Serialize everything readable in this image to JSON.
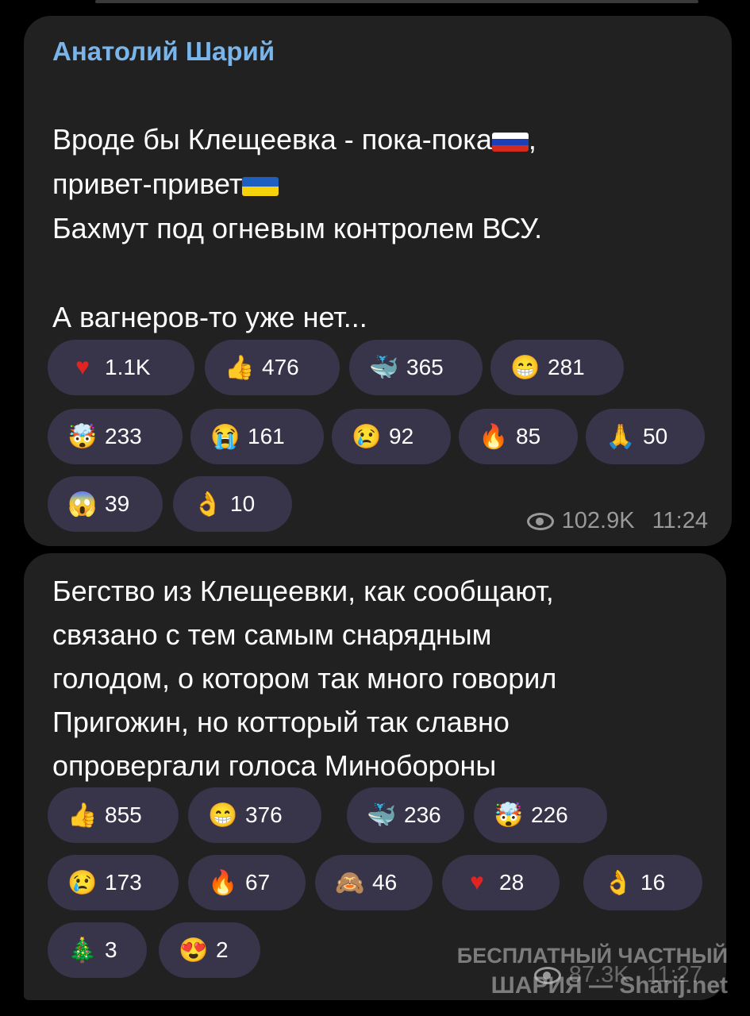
{
  "messages": [
    {
      "author": "Анатолий Шарий",
      "line1a": "Вроде бы Клещеевка - пока-пока",
      "line1b": ",",
      "line2": "привет-привет",
      "para2": "Бахмут под огневым контролем ВСУ.",
      "para3": "А вагнеров-то уже нет...",
      "reactions": [
        {
          "icon": "heart-icon",
          "glyph": "♥",
          "color": "#e02424",
          "count": "1.1K"
        },
        {
          "icon": "thumbs-up-icon",
          "glyph": "👍",
          "color": "#f2b52a",
          "count": "476"
        },
        {
          "icon": "whale-icon",
          "glyph": "🐳",
          "color": "#3d9be3",
          "count": "365"
        },
        {
          "icon": "grinning-face-icon",
          "glyph": "😁",
          "color": "#f6c330",
          "count": "281"
        },
        {
          "icon": "exploding-head-icon",
          "glyph": "🤯",
          "color": "#f0b23a",
          "count": "233"
        },
        {
          "icon": "crying-face-icon",
          "glyph": "😭",
          "color": "#f6c330",
          "count": "161"
        },
        {
          "icon": "sad-tear-face-icon",
          "glyph": "😢",
          "color": "#f6c330",
          "count": "92"
        },
        {
          "icon": "fire-icon",
          "glyph": "🔥",
          "color": "#f05a1a",
          "count": "85"
        },
        {
          "icon": "folded-hands-icon",
          "glyph": "🙏",
          "color": "#f2b52a",
          "count": "50"
        },
        {
          "icon": "screaming-face-icon",
          "glyph": "😱",
          "color": "#f6c330",
          "count": "39"
        },
        {
          "icon": "ok-hand-icon",
          "glyph": "👌",
          "color": "#f2b52a",
          "count": "10"
        }
      ],
      "views": "102.9K",
      "time": "11:24"
    },
    {
      "text": "Бегство из Клещеевки, как сообщают,\nсвязано с тем самым снарядным\nголодом, о котором так много говорил\nПригожин, но котторый так славно\nопровергали голоса Минобороны",
      "reactions": [
        {
          "icon": "thumbs-up-icon",
          "glyph": "👍",
          "color": "#f2b52a",
          "count": "855"
        },
        {
          "icon": "grinning-face-icon",
          "glyph": "😁",
          "color": "#f6c330",
          "count": "376"
        },
        {
          "icon": "whale-icon",
          "glyph": "🐳",
          "color": "#3d9be3",
          "count": "236"
        },
        {
          "icon": "exploding-head-icon",
          "glyph": "🤯",
          "color": "#f0b23a",
          "count": "226"
        },
        {
          "icon": "sad-tear-face-icon",
          "glyph": "😢",
          "color": "#f6c330",
          "count": "173"
        },
        {
          "icon": "fire-icon",
          "glyph": "🔥",
          "color": "#f05a1a",
          "count": "67"
        },
        {
          "icon": "see-no-evil-monkey-icon",
          "glyph": "🙈",
          "color": "#b07a4a",
          "count": "46"
        },
        {
          "icon": "heart-icon",
          "glyph": "♥",
          "color": "#e02424",
          "count": "28"
        },
        {
          "icon": "ok-hand-icon",
          "glyph": "👌",
          "color": "#f2b52a",
          "count": "16"
        },
        {
          "icon": "christmas-tree-icon",
          "glyph": "🎄",
          "color": "#2f9e44",
          "count": "3"
        },
        {
          "icon": "heart-eyes-face-icon",
          "glyph": "😍",
          "color": "#f6c330",
          "count": "2"
        }
      ],
      "views": "87.3K",
      "time": "11:27"
    }
  ],
  "watermark": {
    "line1": "БЕСПЛАТНЫЙ ЧАСТНЫЙ",
    "line2": "ШАРИЯ — Sharij.net"
  }
}
